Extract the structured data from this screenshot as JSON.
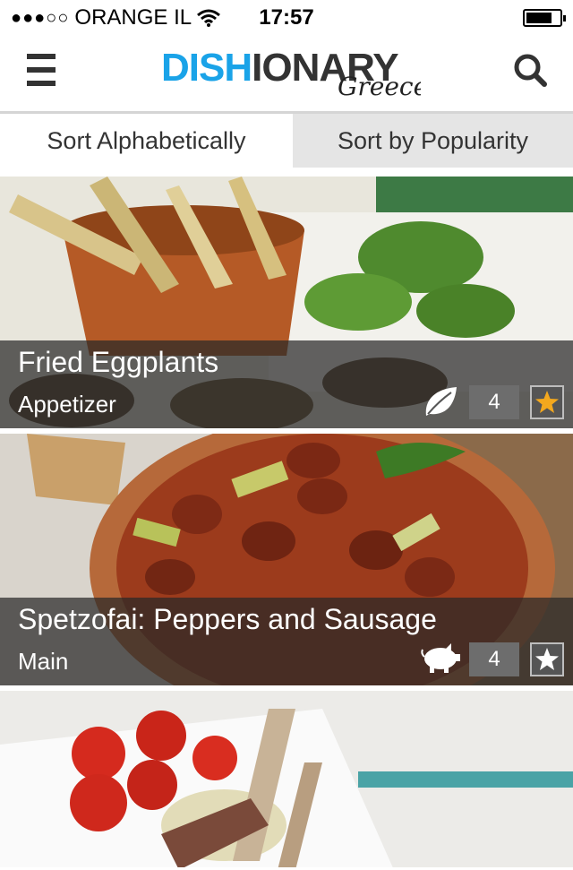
{
  "status_bar": {
    "signal": "●●●○○",
    "carrier": "ORANGE IL",
    "time": "17:57"
  },
  "header": {
    "logo_main": "DISHIONARY",
    "logo_sub": "Greece"
  },
  "sort_tabs": [
    {
      "label": "Sort Alphabetically"
    },
    {
      "label": "Sort by Popularity"
    }
  ],
  "dishes": [
    {
      "title": "Fried Eggplants",
      "category": "Appetizer",
      "count": "4",
      "icon": "leaf-icon",
      "starred": true
    },
    {
      "title": "Spetzofai: Peppers and Sausage",
      "category": "Main",
      "count": "4",
      "icon": "pig-icon",
      "starred": false
    }
  ],
  "colors": {
    "logo_blue": "#1aa3e8",
    "logo_dark": "#333333",
    "star_gold": "#f3a81e",
    "tab_active_bg": "#e5e5e5"
  }
}
